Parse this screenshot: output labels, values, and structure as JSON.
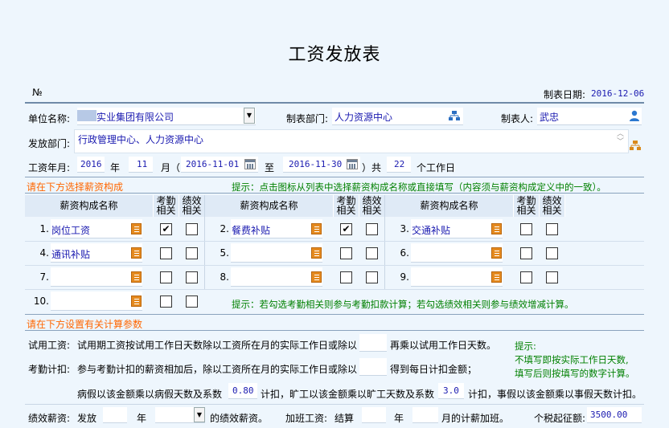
{
  "title": "工资发放表",
  "no_label": "№",
  "date_label": "制表日期:",
  "date_value": "2016-12-06",
  "unit_label": "单位名称:",
  "unit_value": "实业集团有限公司",
  "dept_label": "制表部门:",
  "dept_value": "人力资源中心",
  "maker_label": "制表人:",
  "maker_value": "武忠",
  "issue_dept_label": "发放部门:",
  "issue_dept_value": "行政管理中心、人力资源中心",
  "period": {
    "label": "工资年月:",
    "year": "2016",
    "year_unit": "年",
    "month": "11",
    "month_unit": "月（",
    "start": "2016-11-01",
    "to": "至",
    "end": "2016-11-30",
    "total": "）共",
    "days": "22",
    "days_unit": "个工作日"
  },
  "section1": "请在下方选择薪资构成",
  "hint1": "提示：点击图标从列表中选择薪资构成名称或直接填写（内容须与薪资构成定义中的一致）。",
  "table": {
    "col_name": "薪资构成名称",
    "col_att": "考勤\n相关",
    "col_perf": "绩效\n相关",
    "rows": [
      [
        {
          "n": "1.",
          "name": "岗位工资",
          "att": true,
          "perf": false
        },
        {
          "n": "2.",
          "name": "餐费补贴",
          "att": true,
          "perf": false
        },
        {
          "n": "3.",
          "name": "交通补贴",
          "att": false,
          "perf": false
        }
      ],
      [
        {
          "n": "4.",
          "name": "通讯补贴",
          "att": false,
          "perf": false
        },
        {
          "n": "5.",
          "name": "",
          "att": false,
          "perf": false
        },
        {
          "n": "6.",
          "name": "",
          "att": false,
          "perf": false
        }
      ],
      [
        {
          "n": "7.",
          "name": "",
          "att": false,
          "perf": false
        },
        {
          "n": "8.",
          "name": "",
          "att": false,
          "perf": false
        },
        {
          "n": "9.",
          "name": "",
          "att": false,
          "perf": false
        }
      ],
      [
        {
          "n": "10.",
          "name": "",
          "att": false,
          "perf": false
        }
      ]
    ]
  },
  "hint2": "提示：若勾选考勤相关则参与考勤扣款计算；若勾选绩效相关则参与绩效增减计算。",
  "section2": "请在下方设置有关计算参数",
  "trial_label": "试用工资:",
  "trial_text": "试用期工资按试用工作日天数除以工资所在月的实际工作日或除以",
  "trial_text2": "再乘以试用工作日天数。",
  "att_label": "考勤计扣:",
  "att_text": "参与考勤计扣的薪资相加后，除以工资所在月的实际工作日或除以",
  "att_text2": "得到每日计扣金额；",
  "side_hint": {
    "line1": "提示:",
    "line2": "不填写即按实际工作日天数,",
    "line3": "填写后则按填写的数字计算。"
  },
  "sick_text1": "病假以该金额乘以病假天数及系数",
  "sick_coef": "0.80",
  "sick_text2": "计扣，旷工以该金额乘以旷工天数及系数",
  "absent_coef": "3.0",
  "sick_text3": "计扣，事假以该金额乘以事假天数计扣。",
  "perf_label": "绩效薪资:",
  "perf_issue": "发放",
  "perf_year": "年",
  "perf_month_text": "的绩效薪资。",
  "ot_label": "加班工资:",
  "ot_text": "结算",
  "ot_year": "年",
  "ot_month_text": "月的计薪加班。",
  "tax_label": "个税起征额:",
  "tax_value": "3500.00"
}
